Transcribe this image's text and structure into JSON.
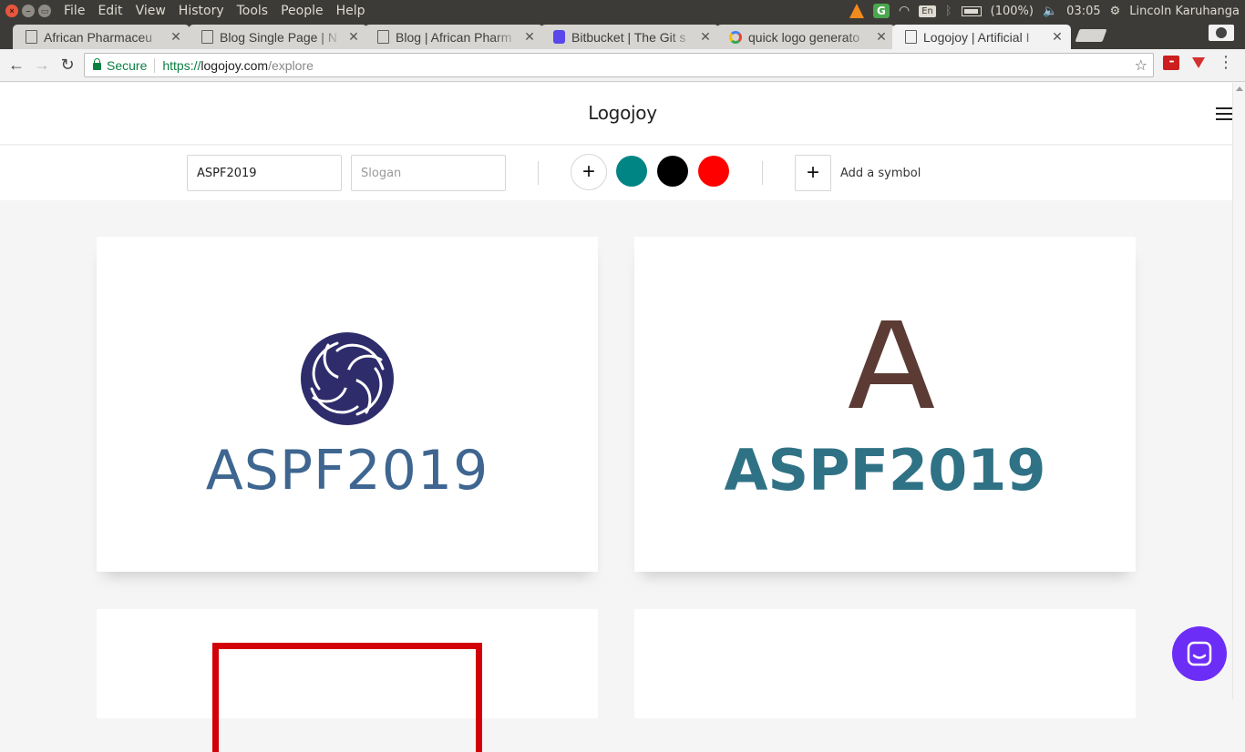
{
  "os": {
    "menus": [
      "File",
      "Edit",
      "View",
      "History",
      "Tools",
      "People",
      "Help"
    ],
    "tray": {
      "keyboard": "En",
      "battery": "(100%)",
      "time": "03:05",
      "user": "Lincoln Karuhanga"
    }
  },
  "tabs": [
    {
      "title": "African Pharmaceu",
      "icon": "page-icon"
    },
    {
      "title": "Blog Single Page | N",
      "icon": "page-icon"
    },
    {
      "title": "Blog | African Pharm",
      "icon": "page-icon"
    },
    {
      "title": "Bitbucket | The Git s",
      "icon": "bitbucket-icon"
    },
    {
      "title": "quick logo generato",
      "icon": "google-icon"
    },
    {
      "title": "Logojoy | Artificial I",
      "icon": "page-icon",
      "active": true
    }
  ],
  "address": {
    "secure_label": "Secure",
    "url_proto": "https://",
    "url_host": "logojoy.com",
    "url_path": "/explore"
  },
  "site": {
    "brand": "Logojoy"
  },
  "controls": {
    "company_name": "ASPF2019",
    "slogan_placeholder": "Slogan",
    "add_symbol_label": "Add a symbol",
    "colors": [
      "#008484",
      "#000000",
      "#ff0000"
    ]
  },
  "cards": [
    {
      "name": "ASPF2019",
      "symbol": "swirl-symbol",
      "color": "#3e6690",
      "symbol_color": "#2e2c6b"
    },
    {
      "name": "ASPF2019",
      "symbol": "letter-a-symbol",
      "symbol_text": "A",
      "color": "#2f7285",
      "symbol_color": "#5b3b34"
    }
  ]
}
